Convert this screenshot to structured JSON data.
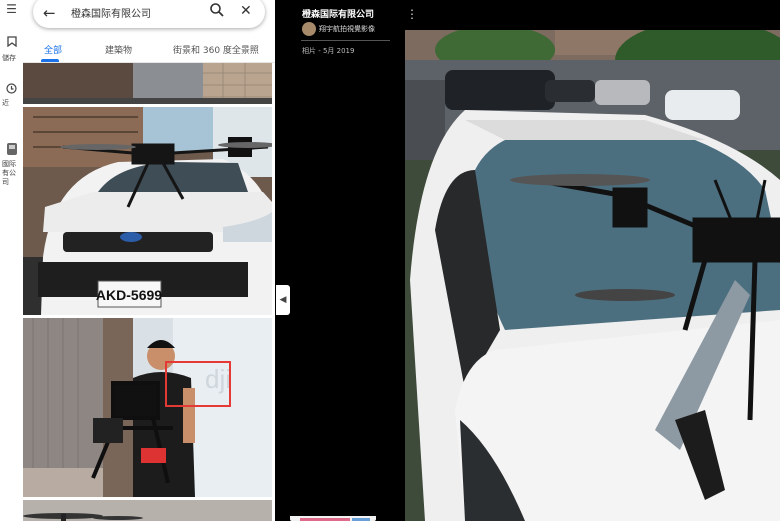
{
  "rail": {
    "menu_icon": "menu-icon",
    "saved_label": "儲存",
    "recent_label": "近",
    "place_label": "國际有公司"
  },
  "search": {
    "query": "橙森国际有限公司",
    "back_icon": "arrow-left-icon",
    "search_icon": "search-icon",
    "close_icon": "close-icon"
  },
  "tabs": [
    {
      "label": "全部",
      "active": true
    },
    {
      "label": "建築物",
      "active": false
    },
    {
      "label": "街景和 360 度全景照",
      "active": false
    }
  ],
  "thumbnails": {
    "car_plate": "AKD-5699"
  },
  "photo": {
    "title": "橙森国际有限公司",
    "author": "翔宇航拍視覺影像",
    "date": "相片 - 5月 2019",
    "more_icon": "more-vertical-icon"
  },
  "colors": {
    "accent": "#1a73e8",
    "viewer_bg": "#000000",
    "highlight_box": "#e53935"
  }
}
